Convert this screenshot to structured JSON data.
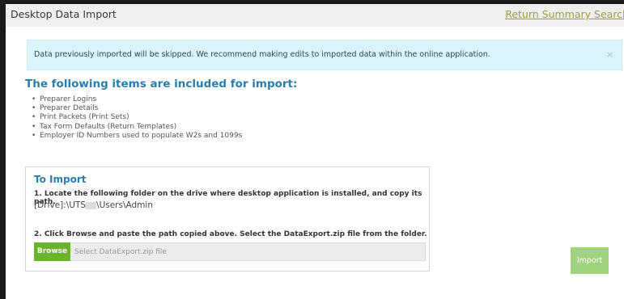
{
  "window": {
    "title": "Desktop Data Import",
    "summary_link": "Return Summary Search"
  },
  "alert": {
    "message": "Data previously imported will be skipped. We recommend making edits to imported data within the online application.",
    "close": "×"
  },
  "items_section": {
    "heading": "The following items are included for import:",
    "items": [
      "Preparer Logins",
      "Preparer Details",
      "Print Packets (Print Sets)",
      "Tax Form Defaults (Return Templates)",
      "Employer ID Numbers used to populate W2s and 1099s"
    ]
  },
  "import_box": {
    "title": "To Import",
    "step1": "1. Locate the following folder on the drive where desktop application is installed, and copy its path.",
    "path_prefix": "[Drive]:\\UTS",
    "path_suffix": "\\Users\\Admin",
    "step2": "2. Click Browse and paste the path copied above. Select the DataExport.zip file from the folder.",
    "browse_label": "Browse",
    "file_placeholder": "Select DataExport.zip file"
  },
  "import_button": "Import",
  "colors": {
    "accent_blue": "#2a7eac",
    "link_olive": "#9aa03e",
    "browse_green": "#6ab42d",
    "import_green": "#9fd37d",
    "alert_bg": "#d9f4fb"
  }
}
